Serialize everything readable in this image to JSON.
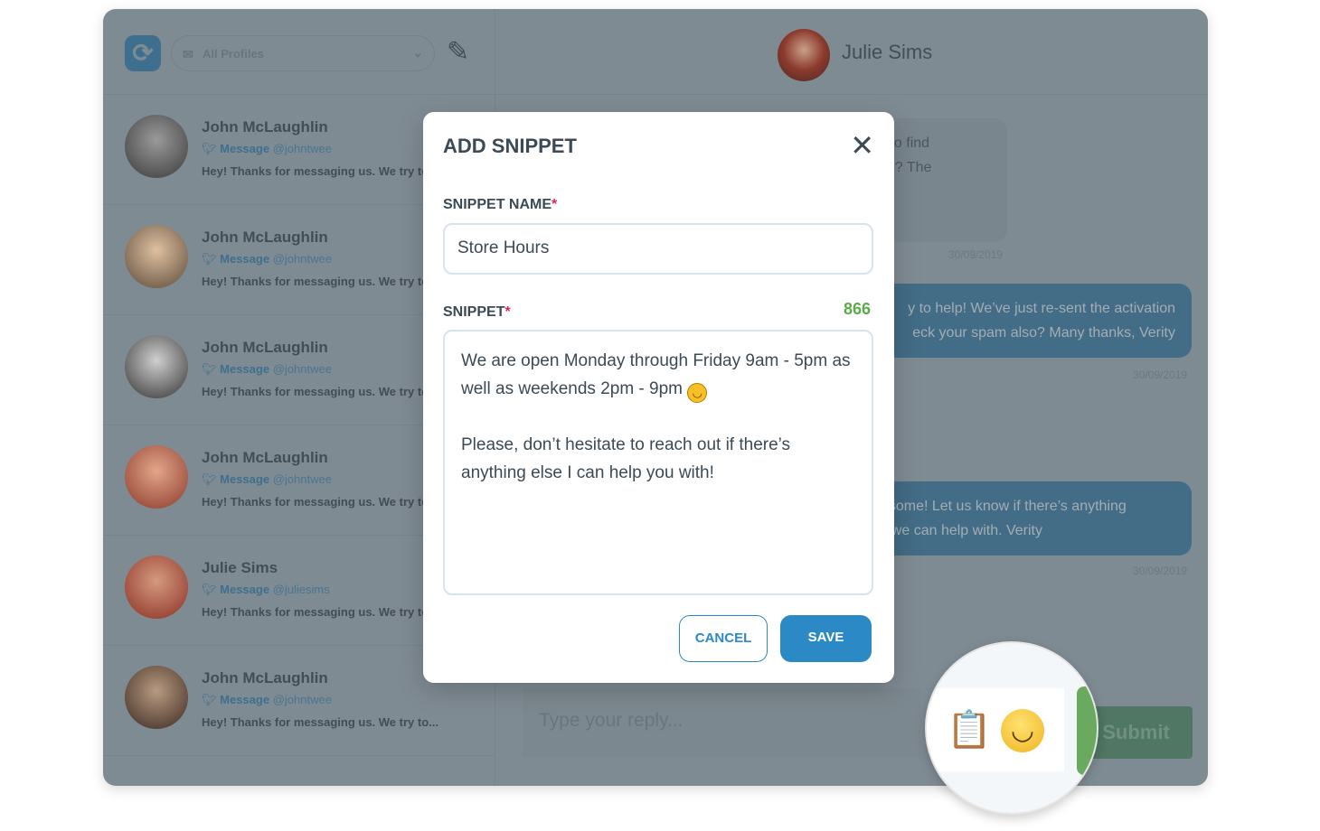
{
  "sidebar": {
    "profiles_label": "All Profiles",
    "conversations": [
      {
        "name": "John McLaughlin",
        "channel": "Message",
        "handle": "@johntwee",
        "preview": "Hey! Thanks for messaging us. We try to"
      },
      {
        "name": "John McLaughlin",
        "channel": "Message",
        "handle": "@johntwee",
        "preview": "Hey! Thanks for messaging us. We try to"
      },
      {
        "name": "John McLaughlin",
        "channel": "Message",
        "handle": "@johntwee",
        "preview": "Hey! Thanks for messaging us. We try to"
      },
      {
        "name": "John McLaughlin",
        "channel": "Message",
        "handle": "@johntwee",
        "preview": "Hey! Thanks for messaging us. We try to"
      },
      {
        "name": "Julie Sims",
        "channel": "Message",
        "handle": "@juliesims",
        "preview": "Hey! Thanks for messaging us. We try to"
      },
      {
        "name": "John McLaughlin",
        "channel": "Message",
        "handle": "@johntwee",
        "preview": "Hey! Thanks for messaging us. We try to..."
      }
    ]
  },
  "chat": {
    "contact_name": "Julie Sims",
    "messages": [
      {
        "text": "t seem to find\ns for me? The",
        "date": "30/09/2019"
      },
      {
        "text": "y to help! We’ve just re-sent the activation\neck your spam also? Many thanks, Verity",
        "date": "30/09/2019"
      },
      {
        "text": "Awesome! Let us know if there’s anything\nelse we can help with. Verity",
        "date": "30/09/2019"
      }
    ],
    "reply_placeholder": "Type your reply...",
    "submit_label": "Submit"
  },
  "modal": {
    "title": "ADD SNIPPET",
    "name_label": "SNIPPET NAME",
    "name_value": "Store Hours",
    "snippet_label": "SNIPPET",
    "required_mark": "*",
    "char_count": "866",
    "snippet_line1": "We are open Monday through Friday 9am - 5pm as well as weekends 2pm - 9pm ",
    "snippet_line2": "\n\nPlease, don’t hesitate to reach out if there’s anything else I can help you with!",
    "cancel_label": "CANCEL",
    "save_label": "SAVE"
  },
  "colors": {
    "primary": "#2b8ac6",
    "count_green": "#5da849",
    "required": "#e0245e",
    "submit_green": "#6aaa5e"
  }
}
